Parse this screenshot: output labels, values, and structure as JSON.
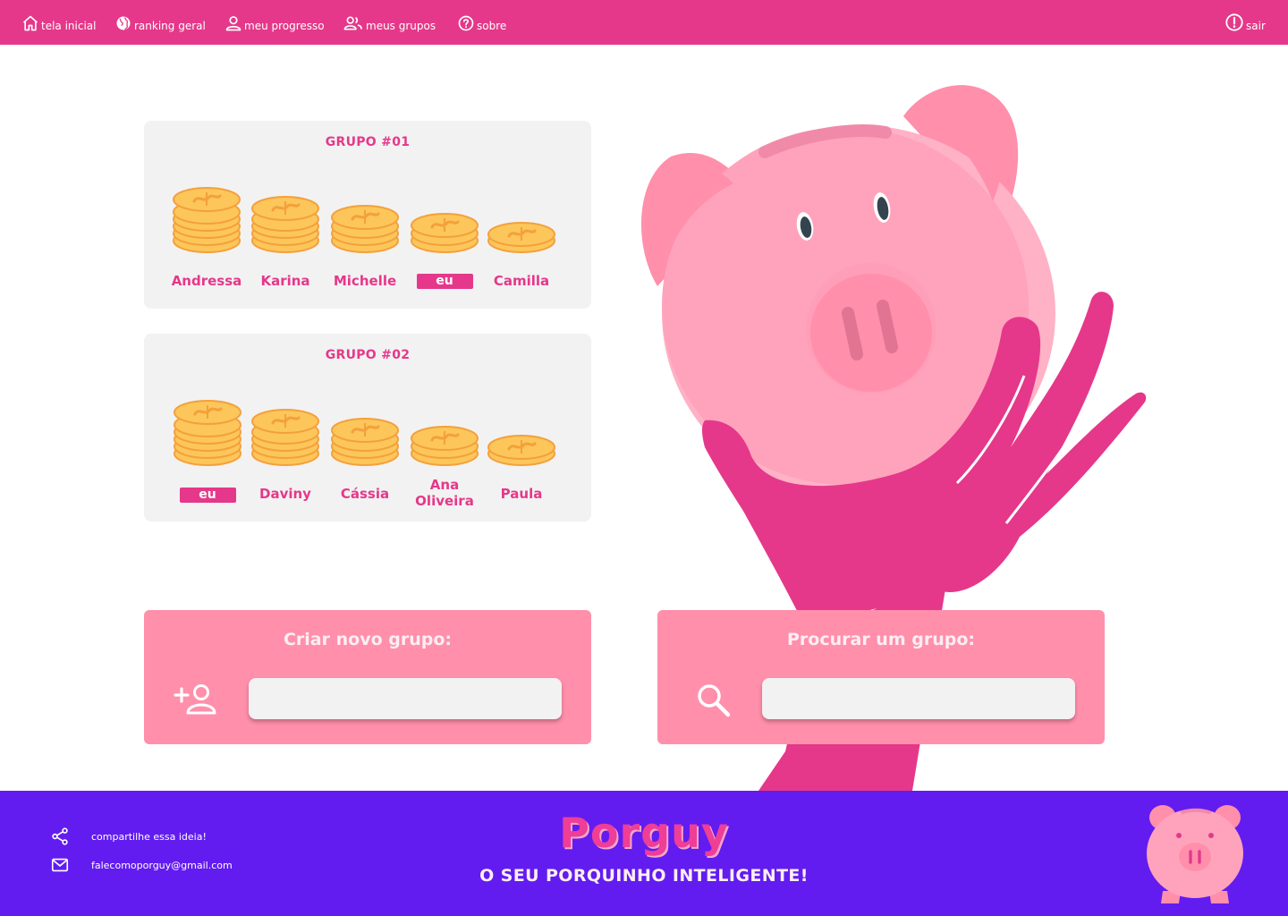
{
  "nav": {
    "items": [
      {
        "label": "tela inicial",
        "icon": "home-icon"
      },
      {
        "label": "ranking geral",
        "icon": "globe-icon"
      },
      {
        "label": "meu progresso",
        "icon": "user-icon"
      },
      {
        "label": "meus grupos",
        "icon": "users-icon"
      },
      {
        "label": "sobre",
        "icon": "help-circle-icon"
      }
    ],
    "logout": {
      "label": "sair",
      "icon": "alert-circle-icon"
    }
  },
  "groups": [
    {
      "title": "GRUPO #01",
      "members": [
        {
          "name": "Andressa",
          "stack": 6,
          "is_me": false
        },
        {
          "name": "Karina",
          "stack": 5,
          "is_me": false
        },
        {
          "name": "Michelle",
          "stack": 4,
          "is_me": false
        },
        {
          "name": "eu",
          "stack": 3,
          "is_me": true
        },
        {
          "name": "Camilla",
          "stack": 2,
          "is_me": false
        }
      ]
    },
    {
      "title": "GRUPO #02",
      "members": [
        {
          "name": "eu",
          "stack": 6,
          "is_me": true
        },
        {
          "name": "Daviny",
          "stack": 5,
          "is_me": false
        },
        {
          "name": "Cássia",
          "stack": 4,
          "is_me": false
        },
        {
          "name": "Ana Oliveira",
          "stack": 3,
          "is_me": false
        },
        {
          "name": "Paula",
          "stack": 2,
          "is_me": false
        }
      ]
    }
  ],
  "create_group": {
    "title": "Criar novo grupo:",
    "icon": "add-user-icon",
    "value": ""
  },
  "search_group": {
    "title": "Procurar um grupo:",
    "icon": "search-icon",
    "value": ""
  },
  "footer": {
    "share_text": "compartilhe essa ideia!",
    "share_icon": "share-icon",
    "email": "falecomoporguy@gmail.com",
    "email_icon": "mail-icon",
    "brand": "Porguy",
    "tagline": "O SEU PORQUINHO INTELIGENTE!"
  },
  "colors": {
    "primary": "#e5388a",
    "card": "#f2f2f2",
    "action_card": "#ff8fab",
    "footer": "#621cf0",
    "coin": "#fcc65a",
    "coin_edge": "#f4a03b"
  }
}
